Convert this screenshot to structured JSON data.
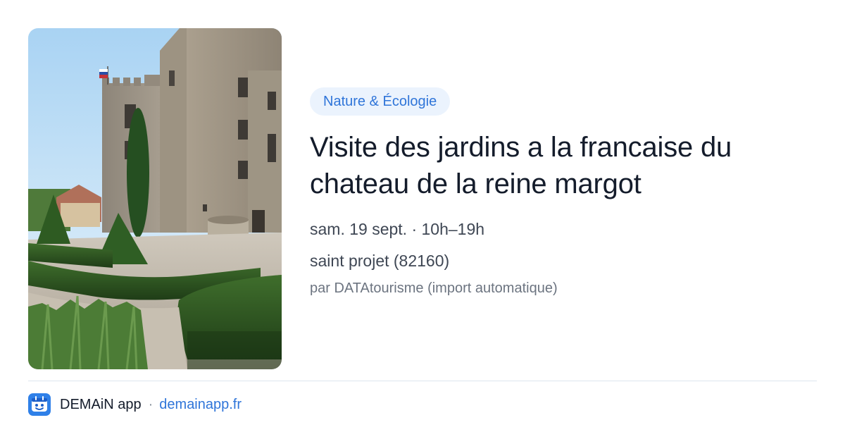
{
  "event": {
    "category": "Nature & Écologie",
    "title": "Visite des jardins a la francaise du chateau de la reine margot",
    "date_time": "sam. 19 sept. · 10h–19h",
    "location": "saint projet (82160)",
    "source": "par DATAtourisme (import automatique)"
  },
  "footer": {
    "app_name": "DEMAiN app",
    "separator": "·",
    "url": "demainapp.fr"
  },
  "colors": {
    "accent": "#2f75d9",
    "badge_background": "#ebf3fd",
    "title_text": "#141c2b",
    "divider": "#dde6ee"
  },
  "icons": {
    "app_logo": "demain-logo-icon"
  }
}
